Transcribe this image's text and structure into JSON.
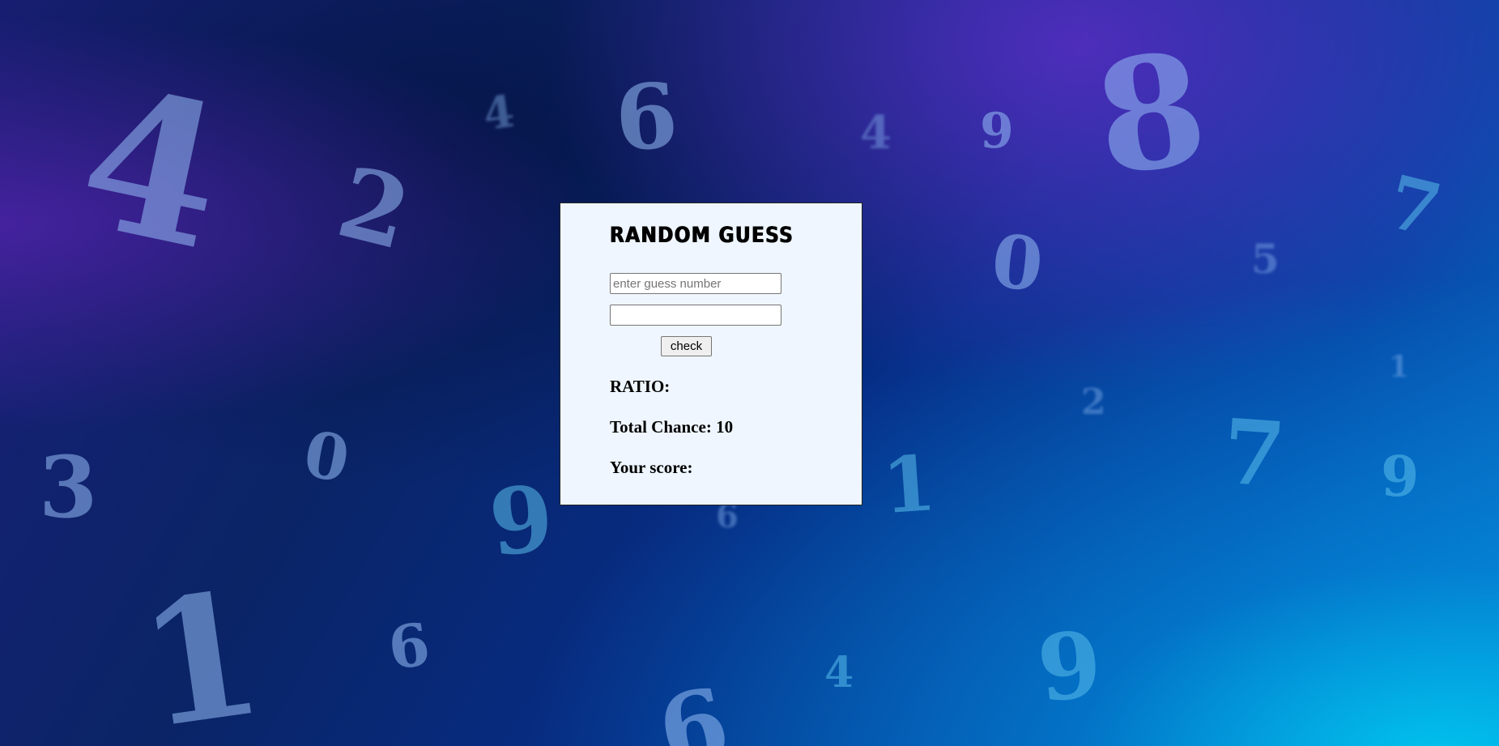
{
  "game": {
    "title": "RANDOM GUESS",
    "guess_input": {
      "placeholder": "enter guess number",
      "value": ""
    },
    "second_input": {
      "placeholder": "",
      "value": ""
    },
    "check_label": "check",
    "ratio_label": "RATIO:",
    "ratio_value": "",
    "chance_label": "Total Chance:",
    "chance_value": "10",
    "score_label": "Your score:",
    "score_value": ""
  },
  "background": {
    "digits": [
      "4",
      "2",
      "4",
      "6",
      "4",
      "9",
      "8",
      "7",
      "0",
      "5",
      "1",
      "2",
      "7",
      "9",
      "3",
      "0",
      "9",
      "6",
      "1",
      "1",
      "6",
      "4",
      "9",
      "6"
    ]
  }
}
